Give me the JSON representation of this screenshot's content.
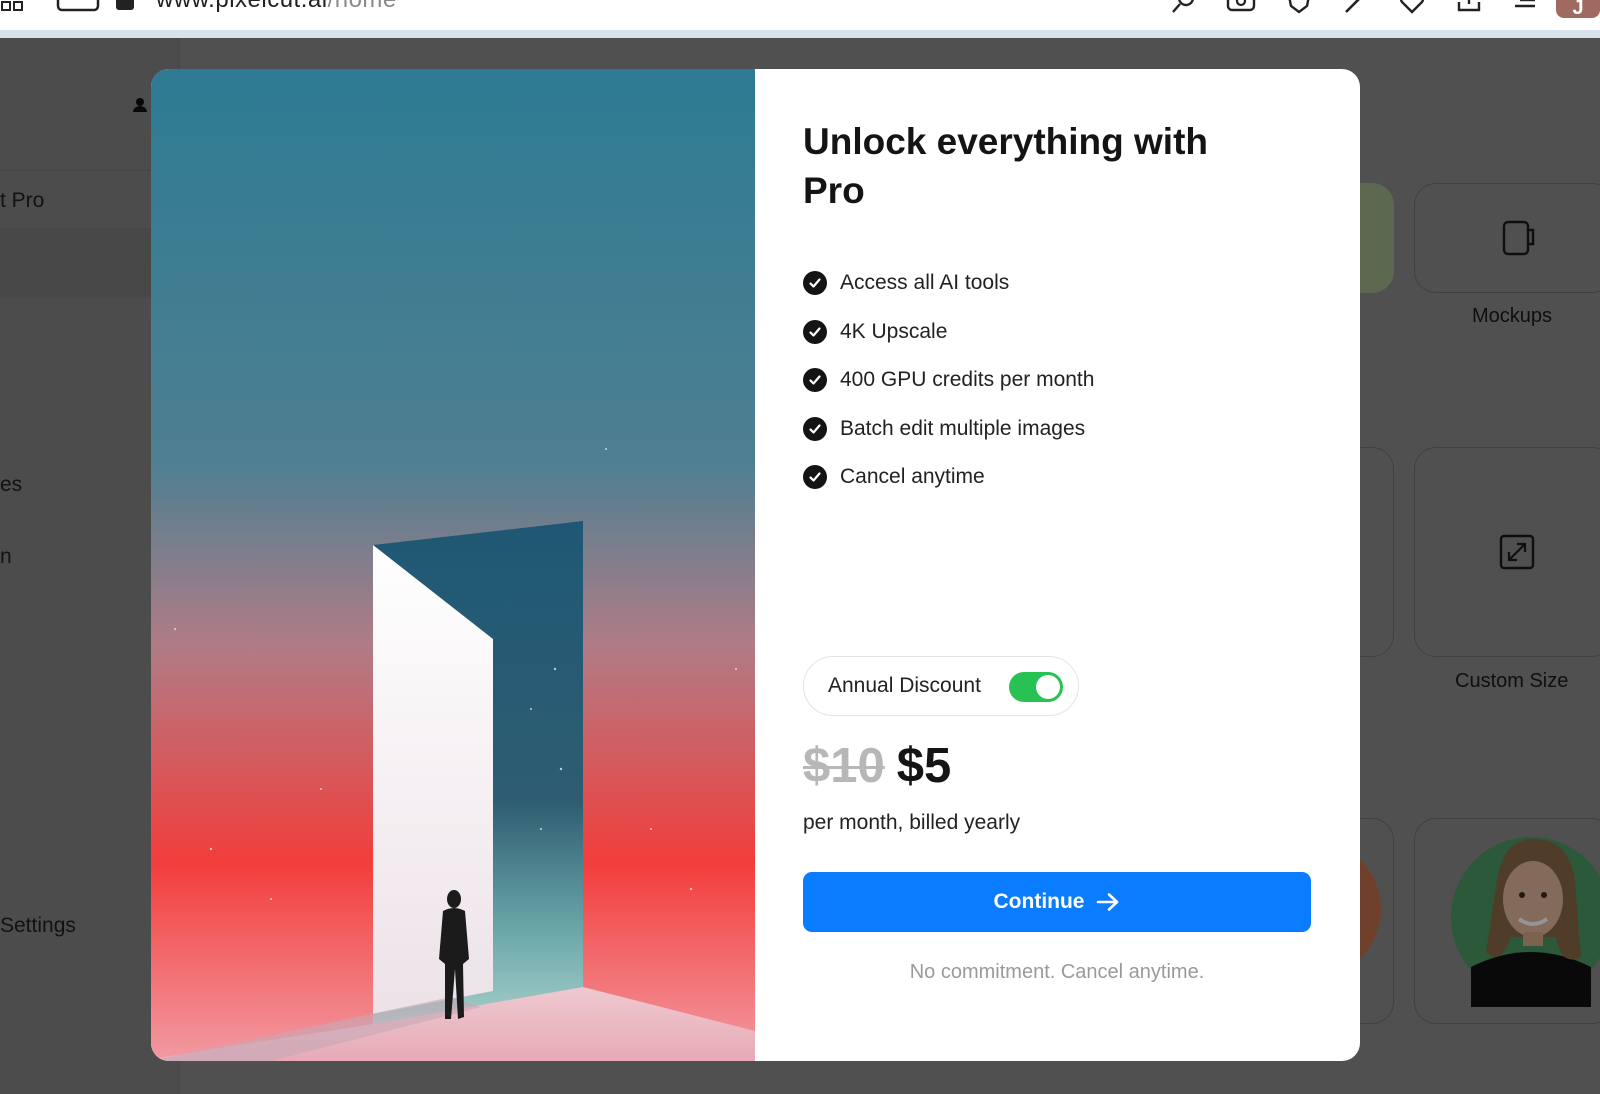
{
  "browser": {
    "url_host": "www.pixelcut.ai",
    "url_path": "/home",
    "icons": [
      "grid-icon",
      "window-icon",
      "key-icon",
      "search-icon",
      "camera-icon",
      "shield-icon",
      "pen-icon",
      "heart-icon",
      "download-icon",
      "reading-list-icon",
      "profile-icon"
    ],
    "profile_initial": "J"
  },
  "sidebar": {
    "items": [
      {
        "label": "t Pro"
      },
      {
        "label": "es"
      },
      {
        "label": "n"
      },
      {
        "label": "Settings"
      }
    ],
    "user_icon": "person-icon"
  },
  "background_tiles": {
    "mockups_label": "Mockups",
    "custom_size_label": "Custom Size"
  },
  "modal": {
    "title": "Unlock everything with Pro",
    "features": [
      "Access all AI tools",
      "4K Upscale",
      "400 GPU credits per month",
      "Batch edit multiple images",
      "Cancel anytime"
    ],
    "annual_discount_label": "Annual Discount",
    "annual_discount_on": true,
    "old_price": "$10",
    "new_price": "$5",
    "billing_text": "per month, billed yearly",
    "continue_label": "Continue",
    "note": "No commitment. Cancel anytime.",
    "colors": {
      "primary": "#0a7cff",
      "toggle_on": "#27c253",
      "check": "#141414"
    }
  }
}
